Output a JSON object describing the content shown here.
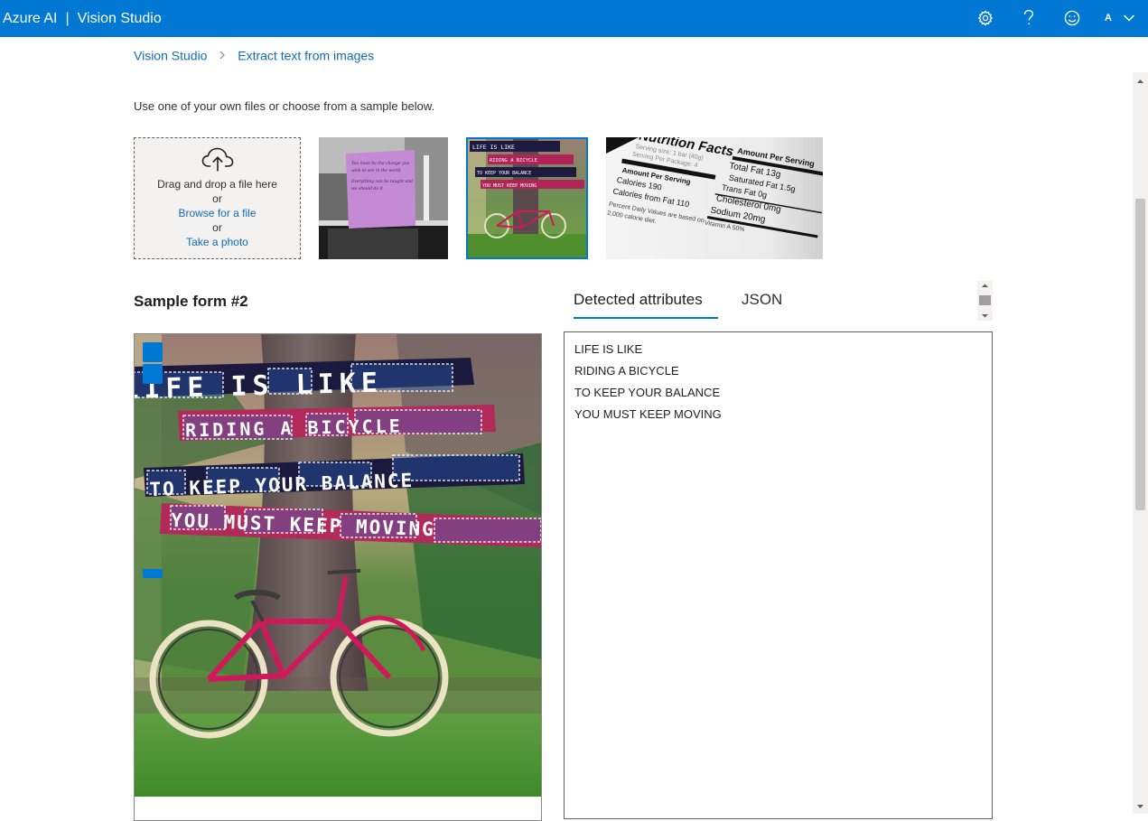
{
  "header": {
    "brand": "Azure AI",
    "divider": "|",
    "product": "Vision Studio",
    "icons": [
      "settings-gear-icon",
      "help-icon",
      "feedback-smile-icon"
    ],
    "avatar_initial": "A"
  },
  "breadcrumb": {
    "items": [
      "Vision Studio",
      "Extract text from images"
    ]
  },
  "intro_text": "Use one of your own files or choose from a sample below.",
  "upload": {
    "drag_text": "Drag and drop a file here",
    "or1": "or",
    "browse_label": "Browse for a file",
    "or2": "or",
    "photo_label": "Take a photo"
  },
  "samples": {
    "handwritten_note": {
      "note_lines": [
        "You must be the change you",
        "wish to see in the world",
        "Everything can be taught and",
        "we should do it"
      ]
    },
    "bicycle_poster": {
      "lines": [
        "LIFE IS LIKE",
        "RIDING A BICYCLE",
        "TO KEEP YOUR BALANCE",
        "YOU MUST KEEP MOVING"
      ]
    },
    "nutrition_label": {
      "title": "Nutrition Facts",
      "amount_header": "Amount Per Serving",
      "serving_size": "Serving size: 1 bar (40g)",
      "servings_per_package": "Serving Per Package: 4",
      "amount_per_serving": "Amount Per Serving",
      "calories": "Calories 190",
      "calories_from_fat": "Calories from Fat 110",
      "daily_note": "Percent Daily Values are based on",
      "diet_note": "2,000 calorie diet.",
      "total_fat": "Total Fat 13g",
      "saturated_fat": "Saturated Fat 1.5g",
      "trans_fat": "Trans Fat 0g",
      "cholesterol": "Cholesterol 0mg",
      "sodium": "Sodium 20mg",
      "vitamin": "Vitamin A 50%",
      "selected": false
    },
    "selected_sample": "bicycle_poster"
  },
  "form_title": "Sample form #2",
  "tabs": [
    {
      "label": "Detected attributes",
      "active": true
    },
    {
      "label": "JSON",
      "active": false
    }
  ],
  "results": {
    "lines": [
      "LIFE IS LIKE",
      "RIDING A BICYCLE",
      "TO KEEP YOUR BALANCE",
      "YOU MUST KEEP MOVING"
    ]
  },
  "colors": {
    "accent": "#0078d4",
    "link": "#0f6cbd",
    "upload_bg": "#f3f2f1"
  }
}
